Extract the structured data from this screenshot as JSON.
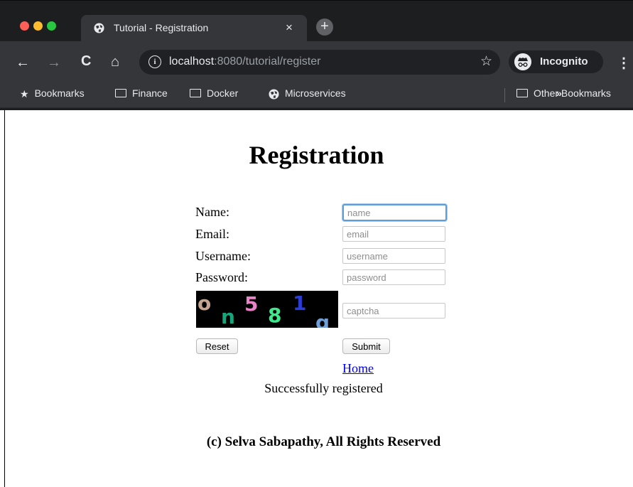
{
  "browser": {
    "tab": {
      "title": "Tutorial - Registration",
      "close": "×"
    },
    "new_tab": "+",
    "nav": {
      "back": "←",
      "forward": "→",
      "reload": "C",
      "home": "⌂",
      "star": "☆",
      "menu": "⋮"
    },
    "address": {
      "host": "localhost",
      "rest": ":8080/tutorial/register",
      "info": "i"
    },
    "incognito": "Incognito",
    "bookmarks": {
      "items": [
        {
          "label": "Bookmarks",
          "icon": "star-icon"
        },
        {
          "label": "Finance",
          "icon": "folder-icon"
        },
        {
          "label": "Docker",
          "icon": "folder-icon"
        },
        {
          "label": "Microservices",
          "icon": "globe-icon"
        }
      ],
      "overflow": "»",
      "other": "Other Bookmarks"
    }
  },
  "page": {
    "title": "Registration",
    "labels": {
      "name": "Name:",
      "email": "Email:",
      "username": "Username:",
      "password": "Password:"
    },
    "placeholders": {
      "name": "name",
      "email": "email",
      "username": "username",
      "password": "password",
      "captcha": "captcha"
    },
    "captcha_text": "on581g",
    "buttons": {
      "reset": "Reset",
      "submit": "Submit"
    },
    "home_link": "Home",
    "status": "Successfully registered",
    "footer": "(c) Selva Sabapathy, All Rights Reserved"
  },
  "colors": {
    "chrome_bg": "#1d1e20",
    "toolbar_bg": "#35363a",
    "focus_ring": "#5e9ed6",
    "link": "#0000ee"
  }
}
